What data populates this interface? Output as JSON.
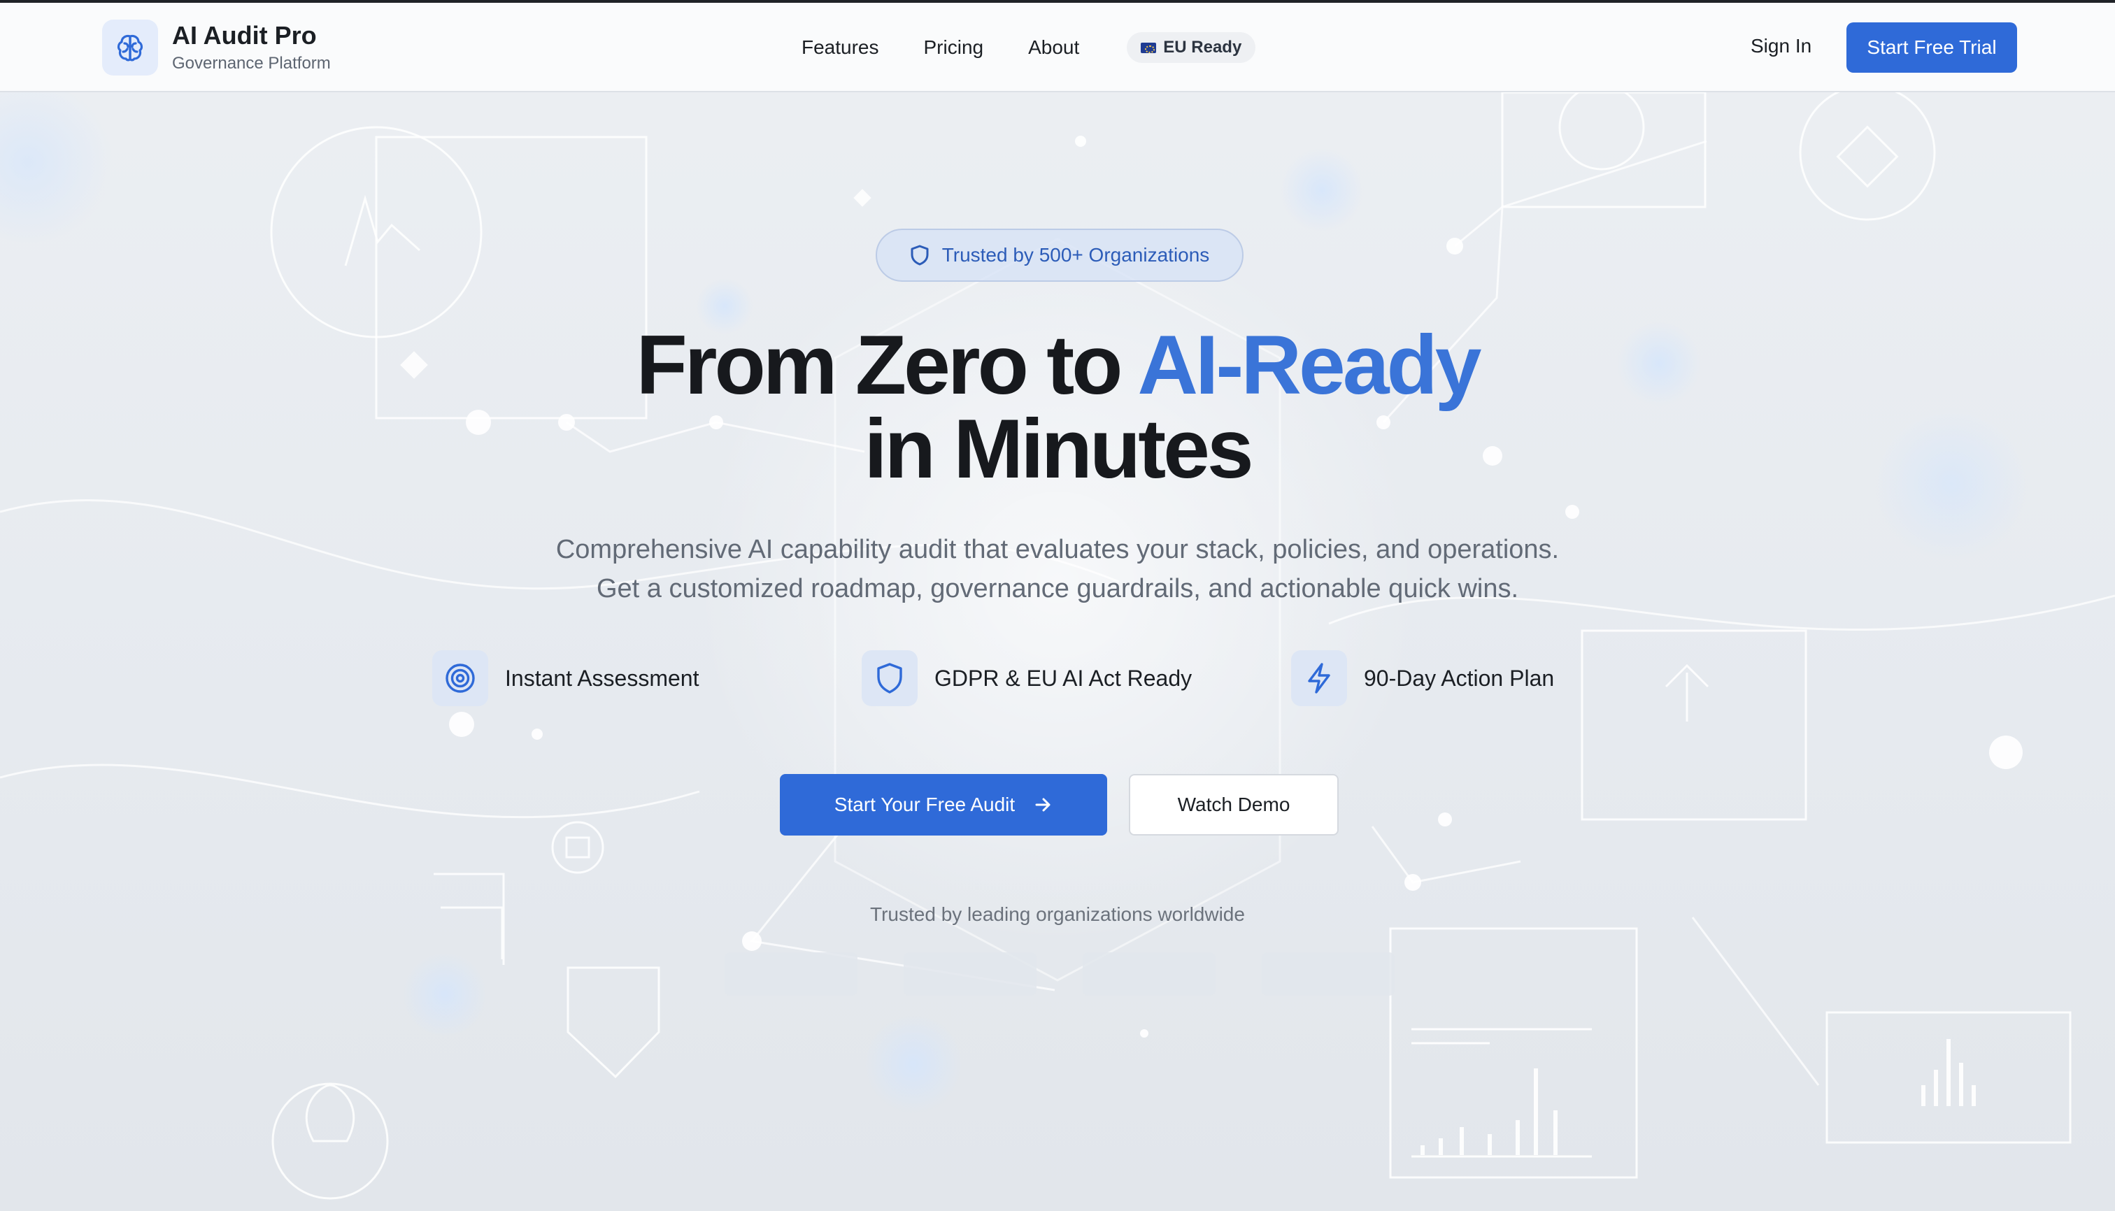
{
  "brand": {
    "name": "AI Audit Pro",
    "tagline": "Governance Platform",
    "icon": "brain-icon"
  },
  "nav": {
    "items": [
      {
        "label": "Features"
      },
      {
        "label": "Pricing"
      },
      {
        "label": "About"
      }
    ],
    "eu_badge": "EU Ready",
    "eu_badge_icon": "eu-flag-icon"
  },
  "header_actions": {
    "sign_in": "Sign In",
    "start_trial": "Start Free Trial"
  },
  "hero": {
    "trust_pill": "Trusted by 500+ Organizations",
    "trust_pill_icon": "shield-icon",
    "headline_prefix": "From Zero to ",
    "headline_accent": "AI-Ready",
    "headline_line2": "in Minutes",
    "subline_1": "Comprehensive AI capability audit that evaluates your stack, policies, and operations.",
    "subline_2": "Get a customized roadmap, governance guardrails, and actionable quick wins.",
    "features": [
      {
        "label": "Instant Assessment",
        "icon": "target-icon"
      },
      {
        "label": "GDPR & EU AI Act Ready",
        "icon": "shield-icon"
      },
      {
        "label": "90-Day Action Plan",
        "icon": "lightning-icon"
      }
    ],
    "primary_cta": "Start Your Free Audit",
    "secondary_cta": "Watch Demo",
    "trusted_line": "Trusted by leading organizations worldwide"
  },
  "colors": {
    "accent": "#2f6ad8",
    "headline_accent": "#3a74d8",
    "text_primary": "#17191d",
    "text_muted": "#626a76",
    "background": "#e9ecf1"
  }
}
